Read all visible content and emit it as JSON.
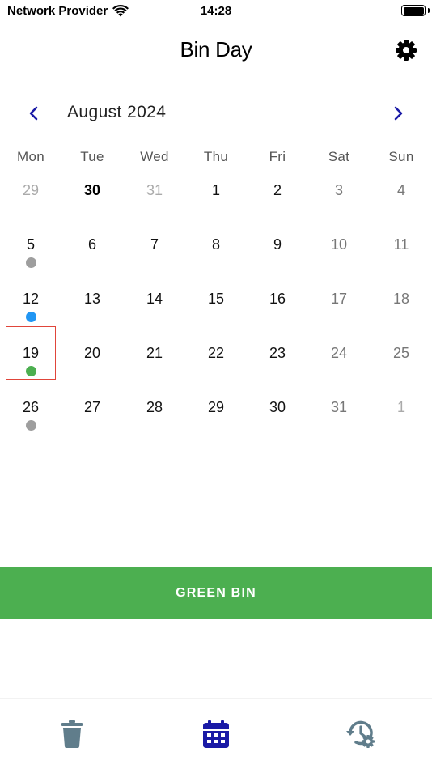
{
  "status_bar": {
    "carrier": "Network Provider",
    "time": "14:28"
  },
  "header": {
    "title": "Bin Day",
    "settings_icon": "gear-icon"
  },
  "calendar": {
    "month_label": "August 2024",
    "prev_icon": "chevron-left-icon",
    "next_icon": "chevron-right-icon",
    "weekdays": [
      "Mon",
      "Tue",
      "Wed",
      "Thu",
      "Fri",
      "Sat",
      "Sun"
    ],
    "weeks": [
      [
        "29",
        "30",
        "31",
        "1",
        "2",
        "3",
        "4"
      ],
      [
        "5",
        "6",
        "7",
        "8",
        "9",
        "10",
        "11"
      ],
      [
        "12",
        "13",
        "14",
        "15",
        "16",
        "17",
        "18"
      ],
      [
        "19",
        "20",
        "21",
        "22",
        "23",
        "24",
        "25"
      ],
      [
        "26",
        "27",
        "28",
        "29",
        "30",
        "31",
        "1"
      ]
    ],
    "today": "30",
    "selected_day": "19",
    "collection_markers": [
      {
        "day": "5",
        "color": "#9e9e9e"
      },
      {
        "day": "12",
        "color": "#2196f3"
      },
      {
        "day": "19",
        "color": "#4caf50"
      },
      {
        "day": "26",
        "color": "#9e9e9e"
      }
    ]
  },
  "bin_banner": {
    "label": "GREEN BIN",
    "color": "#4caf50"
  },
  "tab_bar": {
    "tabs": [
      {
        "icon": "trash-icon",
        "active": false,
        "color": "#607d8b"
      },
      {
        "icon": "calendar-icon",
        "active": true,
        "color": "#1a1aa6"
      },
      {
        "icon": "history-settings-icon",
        "active": false,
        "color": "#607d8b"
      }
    ]
  }
}
